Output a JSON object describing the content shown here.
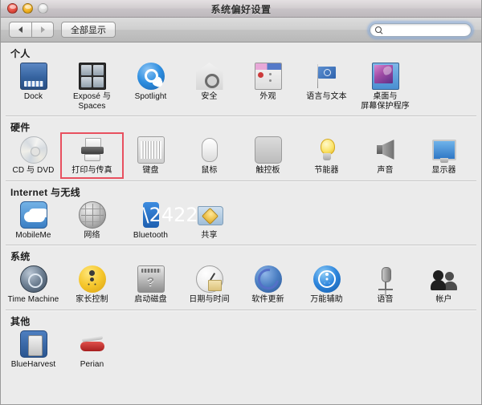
{
  "window": {
    "title": "系统偏好设置",
    "traffic_lights": [
      {
        "name": "close",
        "state": "active"
      },
      {
        "name": "minimize",
        "state": "active"
      },
      {
        "name": "zoom",
        "state": "disabled"
      }
    ]
  },
  "toolbar": {
    "back_label": "◀",
    "forward_label": "▶",
    "show_all_label": "全部显示",
    "search": {
      "value": "",
      "placeholder": ""
    }
  },
  "sections": [
    {
      "id": "personal",
      "title": "个人",
      "items": [
        {
          "label": "Dock",
          "icon": "dock-icon",
          "cls": "i-dock"
        },
        {
          "label": "Exposé 与\nSpaces",
          "icon": "expose-spaces-icon",
          "cls": "i-expose",
          "inner": 4
        },
        {
          "label": "Spotlight",
          "icon": "spotlight-icon",
          "cls": "i-spot"
        },
        {
          "label": "安全",
          "icon": "security-icon",
          "cls": "i-secure"
        },
        {
          "label": "外观",
          "icon": "appearance-icon",
          "cls": "i-appear"
        },
        {
          "label": "语言与文本",
          "icon": "language-text-icon",
          "cls": "i-lang",
          "inner": 1
        },
        {
          "label": "桌面与\n屏幕保护程序",
          "icon": "desktop-screensaver-icon",
          "cls": "i-desk"
        }
      ]
    },
    {
      "id": "hardware",
      "title": "硬件",
      "items": [
        {
          "label": "CD 与 DVD",
          "icon": "cd-dvd-icon",
          "cls": "i-cd"
        },
        {
          "label": "打印与传真",
          "icon": "print-fax-icon",
          "cls": "i-print",
          "inner": 1,
          "highlighted": true
        },
        {
          "label": "键盘",
          "icon": "keyboard-icon",
          "cls": "i-kbd"
        },
        {
          "label": "鼠标",
          "icon": "mouse-icon",
          "cls": "i-mouse"
        },
        {
          "label": "触控板",
          "icon": "trackpad-icon",
          "cls": "i-trackpad"
        },
        {
          "label": "节能器",
          "icon": "energy-saver-icon",
          "cls": "i-energy"
        },
        {
          "label": "声音",
          "icon": "sound-icon",
          "cls": "i-sound"
        },
        {
          "label": "显示器",
          "icon": "displays-icon",
          "cls": "i-display"
        }
      ]
    },
    {
      "id": "internet-wireless",
      "title": "Internet 与无线",
      "items": [
        {
          "label": "MobileMe",
          "icon": "mobileme-icon",
          "cls": "i-mobile"
        },
        {
          "label": "网络",
          "icon": "network-icon",
          "cls": "i-net",
          "inner": 1
        },
        {
          "label": "Bluetooth",
          "icon": "bluetooth-icon",
          "cls": "i-bt"
        },
        {
          "label": "共享",
          "icon": "sharing-icon",
          "cls": "i-share"
        }
      ]
    },
    {
      "id": "system",
      "title": "系统",
      "items": [
        {
          "label": "Time Machine",
          "icon": "time-machine-icon",
          "cls": "i-tm"
        },
        {
          "label": "家长控制",
          "icon": "parental-controls-icon",
          "cls": "i-parent"
        },
        {
          "label": "启动磁盘",
          "icon": "startup-disk-icon",
          "cls": "i-disk"
        },
        {
          "label": "日期与时间",
          "icon": "date-time-icon",
          "cls": "i-date"
        },
        {
          "label": "软件更新",
          "icon": "software-update-icon",
          "cls": "i-update"
        },
        {
          "label": "万能辅助",
          "icon": "universal-access-icon",
          "cls": "i-access",
          "inner": 1
        },
        {
          "label": "语音",
          "icon": "speech-icon",
          "cls": "i-speech",
          "inner": 1
        },
        {
          "label": "帐户",
          "icon": "accounts-icon",
          "cls": "i-accounts"
        }
      ]
    },
    {
      "id": "other",
      "title": "其他",
      "items": [
        {
          "label": "BlueHarvest",
          "icon": "blueharvest-icon",
          "cls": "i-blue"
        },
        {
          "label": "Perian",
          "icon": "perian-icon",
          "cls": "i-perian"
        }
      ]
    }
  ],
  "annotation": {
    "color": "#e8505f",
    "target": "打印与传真"
  }
}
